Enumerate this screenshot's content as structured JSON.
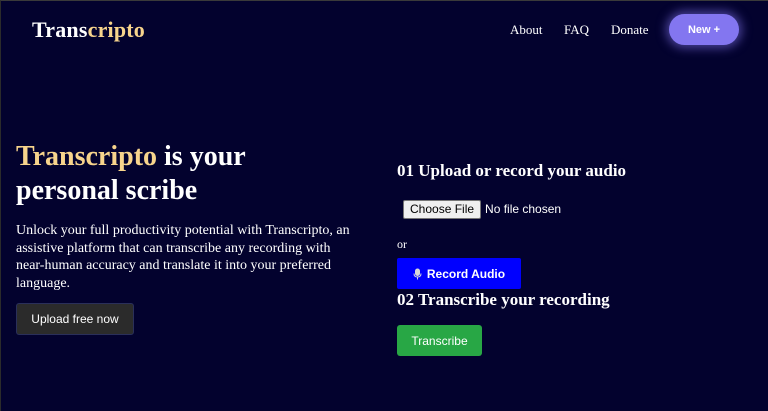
{
  "header": {
    "logo_part1": "Trans",
    "logo_part2": "cripto",
    "nav": {
      "about": "About",
      "faq": "FAQ",
      "donate": "Donate"
    },
    "new_button": "New +"
  },
  "hero": {
    "title_highlight": "Transcripto",
    "title_rest": " is your personal scribe",
    "description": "Unlock your full productivity potential with Transcripto, an assistive platform that can transcribe any recording with near-human accuracy and translate it into your preferred language.",
    "upload_button": "Upload free now"
  },
  "panel": {
    "step1_title": "01 Upload or record your audio",
    "choose_file_button": "Choose File",
    "no_file_text": "No file chosen",
    "or_text": "or",
    "record_button": "Record Audio",
    "step2_title": "02 Transcribe your recording",
    "transcribe_button": "Transcribe"
  },
  "colors": {
    "background": "#03022e",
    "logo_accent": "#f7d48c",
    "new_button": "#8376f0",
    "record_button": "#0000ff",
    "transcribe_button": "#28a745",
    "upload_button": "#2b2b2b"
  },
  "icons": {
    "record": "microphone-icon"
  }
}
